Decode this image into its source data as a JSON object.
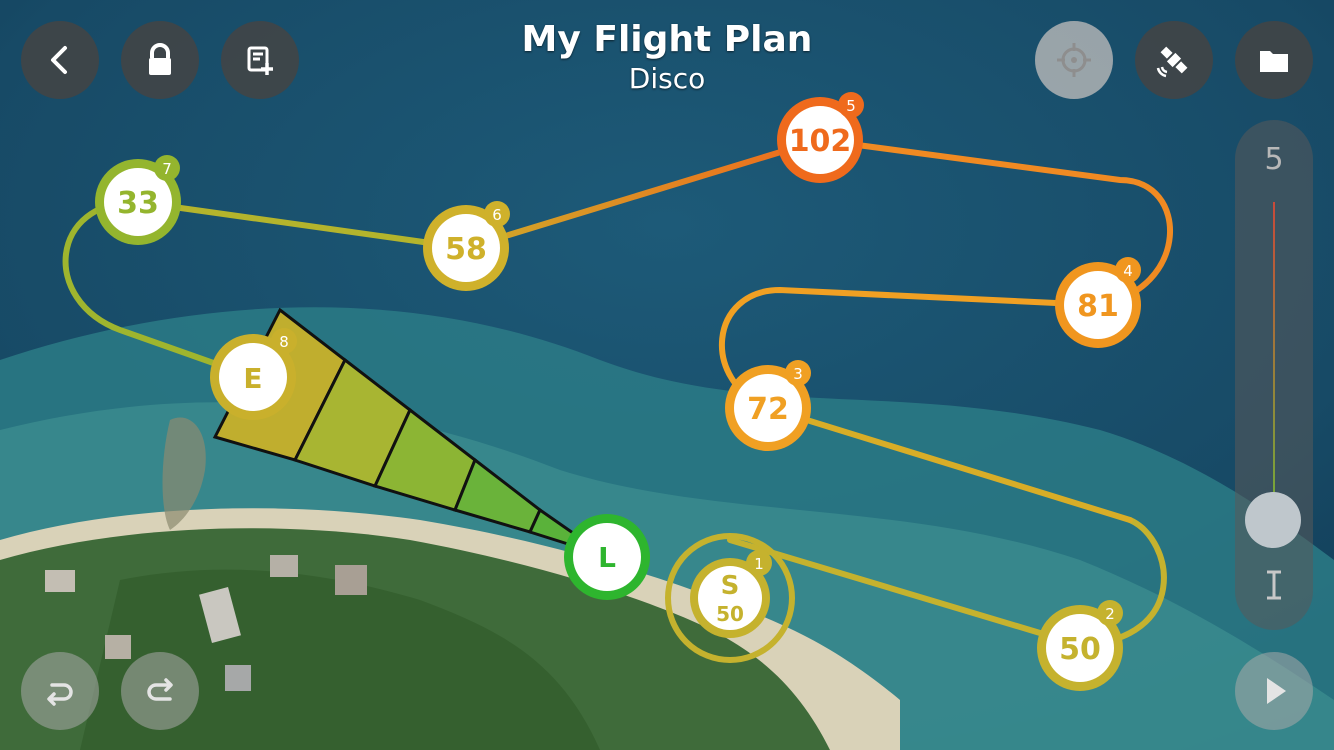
{
  "header": {
    "title": "My Flight Plan",
    "subtitle": "Disco"
  },
  "toolbar": {
    "back_icon": "chevron-left-icon",
    "lock_icon": "lock-icon",
    "add_plan_icon": "note-add-icon",
    "locate_icon": "crosshair-icon",
    "satellite_icon": "satellite-icon",
    "folder_icon": "folder-icon"
  },
  "altitude_slider": {
    "value": "5"
  },
  "waypoints": [
    {
      "index": "1",
      "label": "S",
      "altitude": "50",
      "color": "#c5b22e"
    },
    {
      "index": "2",
      "label": "50",
      "color": "#c5b22e"
    },
    {
      "index": "3",
      "label": "72",
      "color": "#f0a023"
    },
    {
      "index": "4",
      "label": "81",
      "color": "#f0961f"
    },
    {
      "index": "5",
      "label": "102",
      "color": "#ef6a1c"
    },
    {
      "index": "6",
      "label": "58",
      "color": "#cfb12b"
    },
    {
      "index": "7",
      "label": "33",
      "color": "#94b52e"
    },
    {
      "index": "8",
      "label": "E",
      "color": "#c9b02c"
    }
  ],
  "landing": {
    "label": "L",
    "color": "#2eb52e"
  },
  "bottom_controls": {
    "undo_icon": "undo-icon",
    "redo_icon": "redo-icon",
    "play_icon": "play-icon"
  }
}
